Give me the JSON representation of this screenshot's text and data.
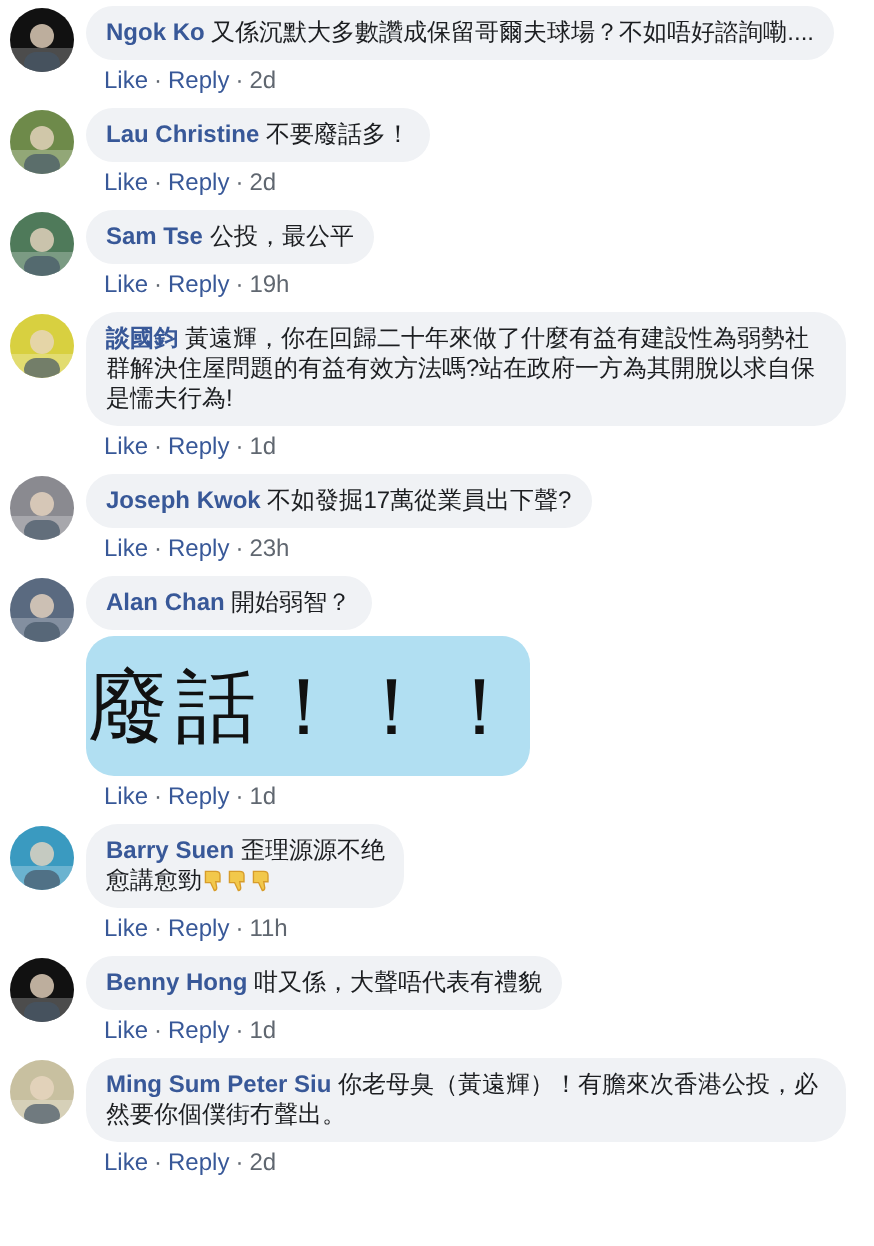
{
  "separator": "·",
  "comments": [
    {
      "name": "Ngok Ko",
      "text": "又係沉默大多數讚成保留哥爾夫球場？不如唔好諮詢嘞....",
      "actions": [
        "Like",
        "Reply"
      ],
      "time": "2d"
    },
    {
      "name": "Lau Christine",
      "text": "不要廢話多！",
      "actions": [
        "Like",
        "Reply"
      ],
      "time": "2d"
    },
    {
      "name": "Sam Tse",
      "text": "公投，最公平",
      "actions": [
        "Like",
        "Reply"
      ],
      "time": "19h"
    },
    {
      "name": "談國鈞",
      "text": "黃遠輝，你在回歸二十年來做了什麼有益有建設性為弱勢社群解決住屋問題的有益有效方法嗎?站在政府一方為其開脫以求自保是懦夫行為!",
      "actions": [
        "Like",
        "Reply"
      ],
      "time": "1d"
    },
    {
      "name": "Joseph Kwok",
      "text": "不如發掘17萬從業員出下聲?",
      "actions": [
        "Like",
        "Reply"
      ],
      "time": "23h"
    },
    {
      "name": "Alan Chan",
      "text": "開始弱智？",
      "sticker": {
        "text": "廢話！！！"
      },
      "actions": [
        "Like",
        "Reply"
      ],
      "time": "1d"
    },
    {
      "name": "Barry Suen",
      "text": "歪理源源不绝",
      "text_lines": [
        "愈講愈勁"
      ],
      "trailing_icons": [
        {
          "kind": "thumbs-down"
        },
        {
          "kind": "thumbs-down"
        },
        {
          "kind": "thumbs-down"
        }
      ],
      "actions": [
        "Like",
        "Reply"
      ],
      "time": "11h"
    },
    {
      "name": "Benny Hong",
      "text": "咁又係，大聲唔代表有禮貌",
      "actions": [
        "Like",
        "Reply"
      ],
      "time": "1d"
    },
    {
      "name": "Ming Sum Peter Siu",
      "text": "你老母臭（黃遠輝）！有膽來次香港公投，必然要你個僕街冇聲出。",
      "actions": [
        "Like",
        "Reply"
      ],
      "time": "2d"
    }
  ]
}
